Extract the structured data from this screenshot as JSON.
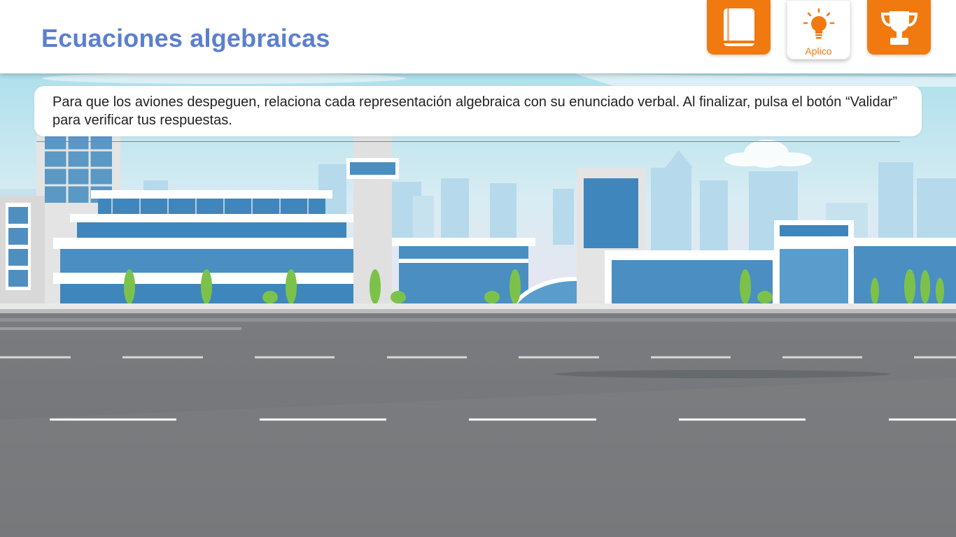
{
  "header": {
    "title": "Ecuaciones algebraicas",
    "nav": {
      "book_icon": "book-icon",
      "apply_label": "Aplico",
      "apply_icon": "lightbulb-icon",
      "trophy_icon": "trophy-icon"
    }
  },
  "instruction": {
    "text": "Para que los aviones despeguen, relaciona cada representación algebraica con su enunciado verbal. Al finalizar, pulsa el botón “Validar” para verificar tus respuestas."
  },
  "colors": {
    "accent": "#f07a10",
    "title": "#5b7fd0",
    "sky": "#cfe6ef",
    "runway": "#7e8082"
  }
}
